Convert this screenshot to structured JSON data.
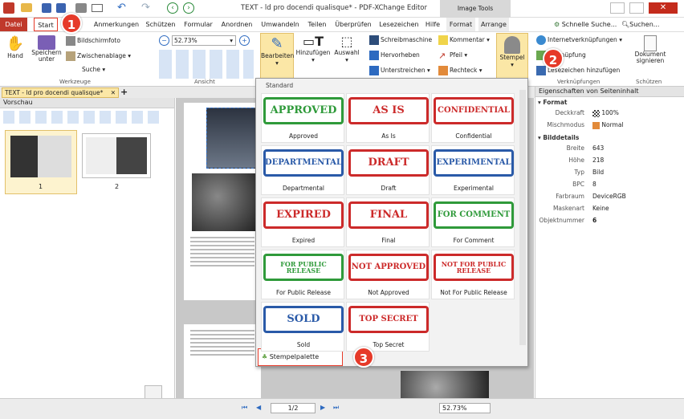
{
  "title": "TEXT - ld pro docendi qualisque* - PDF-XChange Editor",
  "context_tab": "Image Tools",
  "quick_search": "Schnelle Suche...",
  "search_label": "Suchen...",
  "menu": [
    "Datei",
    "Start",
    "Anmerkungen",
    "Schützen",
    "Formular",
    "Anordnen",
    "Umwandeln",
    "Teilen",
    "Überprüfen",
    "Lesezeichen",
    "Hilfe",
    "Format",
    "Arrange"
  ],
  "ribbon": {
    "hand": "Hand",
    "save": "Speichern\nunter",
    "screenshot": "Bildschirmfoto",
    "clipboard": "Zwischenablage",
    "search": "Suche",
    "group_tools": "Werkzeuge",
    "zoom": "52.73%",
    "group_view": "Ansicht",
    "edit": "Bearbeiten",
    "add": "Hinzufügen",
    "select": "Auswahl",
    "typewriter": "Schreibmaschine",
    "highlight": "Hervorheben",
    "underline": "Unterstreichen",
    "comment": "Kommentar",
    "arrow": "Pfeil",
    "rectangle": "Rechteck",
    "stamp": "Stempel",
    "internet_links": "Internetverknüpfungen",
    "link": "Verknüpfung",
    "add_bookmark": "Lesezeichen hinzufügen",
    "group_links": "Verknüpfungen",
    "sign_doc": "Dokument\nsignieren",
    "group_protect": "Schützen"
  },
  "doc_tab": "TEXT - ld pro docendi qualisque*",
  "preview": {
    "title": "Vorschau",
    "pages": [
      "1",
      "2"
    ]
  },
  "stamp_palette": {
    "section": "Standard",
    "stamps": [
      {
        "text": "APPROVED",
        "label": "Approved",
        "color": "#2f9a3a"
      },
      {
        "text": "AS IS",
        "label": "As Is",
        "color": "#cc2a2a"
      },
      {
        "text": "CONFIDENTIAL",
        "label": "Confidential",
        "color": "#cc2a2a"
      },
      {
        "text": "DEPARTMENTAL",
        "label": "Departmental",
        "color": "#2a5aa8"
      },
      {
        "text": "DRAFT",
        "label": "Draft",
        "color": "#cc2a2a"
      },
      {
        "text": "EXPERIMENTAL",
        "label": "Experimental",
        "color": "#2a5aa8"
      },
      {
        "text": "EXPIRED",
        "label": "Expired",
        "color": "#cc2a2a"
      },
      {
        "text": "FINAL",
        "label": "Final",
        "color": "#cc2a2a"
      },
      {
        "text": "FOR COMMENT",
        "label": "For Comment",
        "color": "#2f9a3a"
      },
      {
        "text": "FOR PUBLIC RELEASE",
        "label": "For Public Release",
        "color": "#2f9a3a"
      },
      {
        "text": "NOT APPROVED",
        "label": "Not Approved",
        "color": "#cc2a2a"
      },
      {
        "text": "NOT FOR PUBLIC RELEASE",
        "label": "Not For Public Release",
        "color": "#cc2a2a"
      },
      {
        "text": "SOLD",
        "label": "Sold",
        "color": "#2a5aa8"
      },
      {
        "text": "TOP SECRET",
        "label": "Top Secret",
        "color": "#cc2a2a"
      }
    ],
    "palette_button": "Stempelpalette"
  },
  "properties": {
    "title": "Eigenschaften von Seiteninhalt",
    "format_section": "Format",
    "opacity_key": "Deckkraft",
    "opacity_val": "100%",
    "blend_key": "Mischmodus",
    "blend_val": "Normal",
    "details_section": "Bilddetails",
    "rows": [
      {
        "k": "Breite",
        "v": "643"
      },
      {
        "k": "Höhe",
        "v": "218"
      },
      {
        "k": "Typ",
        "v": "Bild"
      },
      {
        "k": "BPC",
        "v": "8"
      },
      {
        "k": "Farbraum",
        "v": "DeviceRGB"
      },
      {
        "k": "Maskenart",
        "v": "Keine"
      },
      {
        "k": "Objektnummer",
        "v": "6"
      }
    ]
  },
  "status": {
    "page": "1/2",
    "zoom": "52.73%"
  },
  "callouts": [
    "1",
    "2",
    "3"
  ],
  "colors": {
    "accent": "#e63a29",
    "context_tab": "#d8d8d8",
    "file_tab": "#c0392b",
    "palette_bg": "#f2f2f2"
  }
}
